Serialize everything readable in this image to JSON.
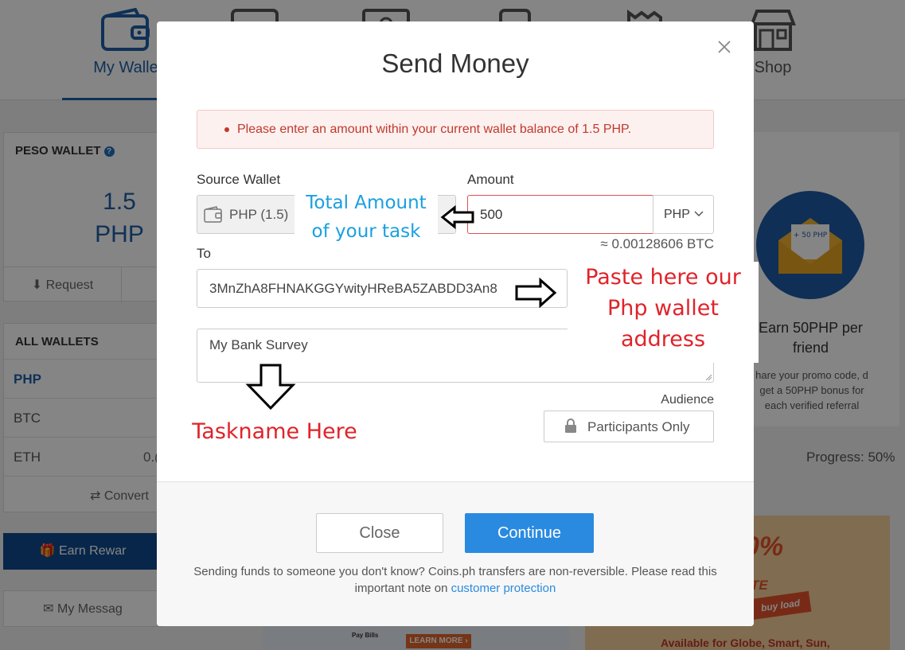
{
  "nav": {
    "items": [
      {
        "label": "My Wallet",
        "icon": "wallet-icon"
      },
      {
        "label": "",
        "icon": "card-icon"
      },
      {
        "label": "",
        "icon": "bill-icon"
      },
      {
        "label": "",
        "icon": "phone-icon"
      },
      {
        "label": "",
        "icon": "receipt-icon"
      },
      {
        "label": "Shop",
        "icon": "shop-icon"
      }
    ],
    "visible_left": "My Walle",
    "visible_right": "Shop"
  },
  "peso_wallet": {
    "title": "PESO WALLET",
    "help_icon": "question-circle-icon",
    "balance_amount": "1.5",
    "balance_currency": "PHP",
    "request_label": "Request"
  },
  "all_wallets": {
    "title": "ALL WALLETS",
    "rows": [
      {
        "label": "PHP",
        "value": "",
        "highlight": true
      },
      {
        "label": "BTC",
        "value": ""
      },
      {
        "label": "ETH",
        "value": "0.("
      }
    ],
    "convert_label": "Convert"
  },
  "earn_rewards_label": "Earn Rewar",
  "my_messages_label": "My Messag",
  "promo": {
    "badge": "+ 50 PHP",
    "title": "Earn 50PHP per friend",
    "description": "hare your promo code, d get a 50PHP bonus for each verified referral"
  },
  "progress_label": "Progress: 50%",
  "banner_left": {
    "learn_more": "LEARN MORE ›",
    "pay_bills": "Pay Bills"
  },
  "banner_right": {
    "percent": "0%",
    "fragment": "TE",
    "buy_load": "buy load",
    "available": "Available for Globe, Smart, Sun,"
  },
  "modal": {
    "title": "Send Money",
    "alert_message": "Please enter an amount within your current wallet balance of 1.5 PHP.",
    "source_wallet_label": "Source Wallet",
    "source_wallet_value": "PHP (1.5)",
    "amount_label": "Amount",
    "amount_value": "500",
    "currency": "PHP",
    "btc_equivalent": "≈ 0.00128606 BTC",
    "to_label": "To",
    "to_value": "3MnZhA8FHNAKGGYwityHReBA5ZABDD3An8",
    "note_value": "My Bank Survey",
    "audience_label": "Audience",
    "audience_value": "Participants Only",
    "close_label": "Close",
    "continue_label": "Continue",
    "footer_note": "Sending funds to someone you don't know? Coins.ph transfers are non-reversible. Please read this important note on ",
    "footer_link": "customer protection"
  },
  "annotations": {
    "total_amount_line1": "Total Amount",
    "total_amount_line2": "of your task",
    "paste_line1": "Paste here our",
    "paste_line2": "Php wallet",
    "paste_line3": "address",
    "taskname": "Taskname Here"
  },
  "colors": {
    "brand_blue": "#1f5fa8",
    "continue_blue": "#2a8ae0",
    "error_red": "#c0392b",
    "annotation_blue": "#1aa0e0",
    "annotation_red": "#e0232a"
  }
}
